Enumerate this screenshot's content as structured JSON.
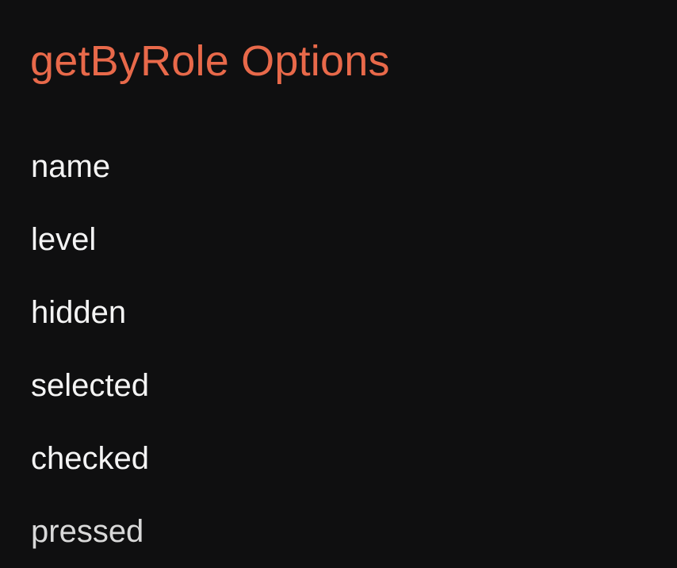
{
  "slide": {
    "title": "getByRole Options",
    "options": [
      "name",
      "level",
      "hidden",
      "selected",
      "checked",
      "pressed"
    ]
  },
  "colors": {
    "background": "#0f0f10",
    "title": "#e8694a",
    "text": "#f4f4f4"
  }
}
